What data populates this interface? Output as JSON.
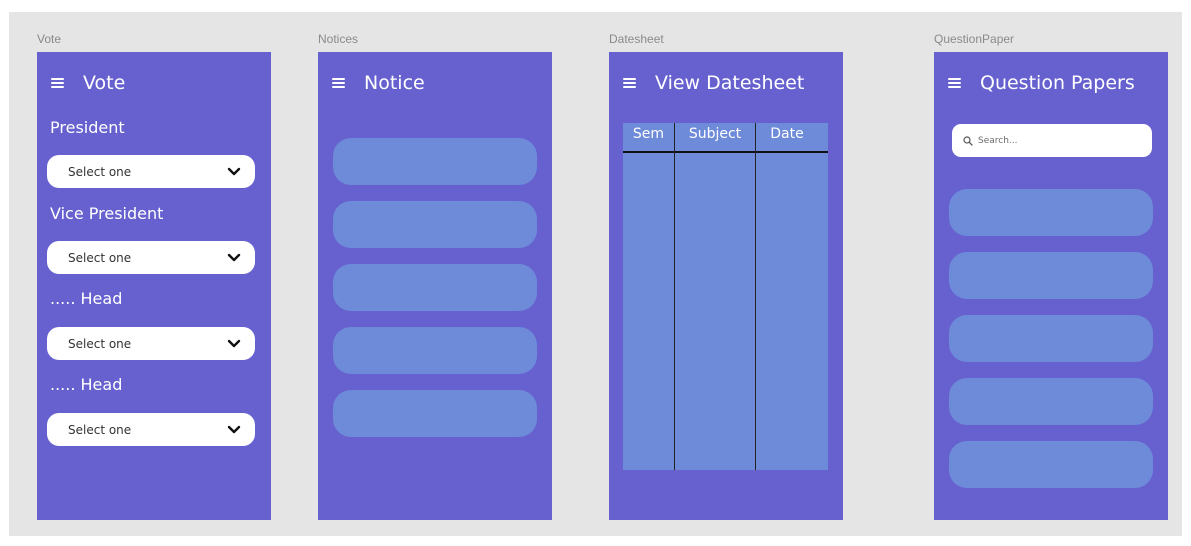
{
  "colors": {
    "canvas": "#e5e5e5",
    "frame": "#6661cf",
    "card": "#6e8bd9",
    "white": "#ffffff"
  },
  "frames": {
    "vote": {
      "label": "Vote",
      "title": "Vote",
      "menu_icon": "hamburger-menu-icon",
      "fields": [
        {
          "label": "President",
          "select": "Select one"
        },
        {
          "label": "Vice President",
          "select": "Select one"
        },
        {
          "label": "..... Head",
          "select": "Select one"
        },
        {
          "label": "..... Head",
          "select": "Select one"
        }
      ],
      "dropdown_icon": "chevron-down-icon"
    },
    "notices": {
      "label": "Notices",
      "title": "Notice",
      "menu_icon": "hamburger-menu-icon"
    },
    "datesheet": {
      "label": "Datesheet",
      "title": "View Datesheet",
      "menu_icon": "hamburger-menu-icon",
      "table": {
        "columns": [
          "Sem",
          "Subject",
          "Date"
        ]
      }
    },
    "question_paper": {
      "label": "QuestionPaper",
      "title": "Question Papers",
      "menu_icon": "hamburger-menu-icon",
      "search": {
        "placeholder": "Search...",
        "icon": "search-icon"
      }
    }
  }
}
